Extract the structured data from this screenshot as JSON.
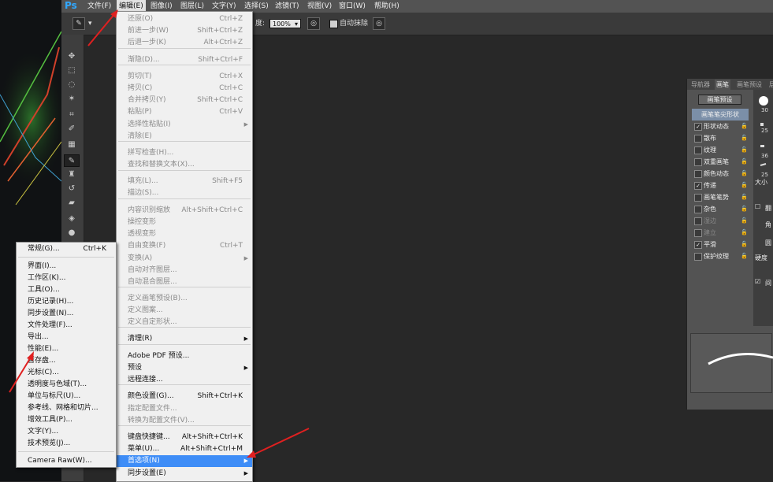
{
  "app": {
    "logo": "Ps"
  },
  "menubar": {
    "items": [
      {
        "label": "文件(F)"
      },
      {
        "label": "编辑(E)"
      },
      {
        "label": "图像(I)"
      },
      {
        "label": "图层(L)"
      },
      {
        "label": "文字(Y)"
      },
      {
        "label": "选择(S)"
      },
      {
        "label": "滤镜(T)"
      },
      {
        "label": "视图(V)"
      },
      {
        "label": "窗口(W)"
      },
      {
        "label": "帮助(H)"
      }
    ]
  },
  "options": {
    "opacity_label": "度:",
    "opacity_value": "100%",
    "auto_erase": "自动抹除"
  },
  "edit_menu": {
    "items": [
      {
        "label": "还原(O)",
        "shortcut": "Ctrl+Z",
        "disabled": true
      },
      {
        "label": "前进一步(W)",
        "shortcut": "Shift+Ctrl+Z",
        "disabled": true
      },
      {
        "label": "后退一步(K)",
        "shortcut": "Alt+Ctrl+Z",
        "disabled": true
      },
      {
        "label": "渐隐(D)...",
        "shortcut": "Shift+Ctrl+F",
        "disabled": true
      },
      {
        "label": "剪切(T)",
        "shortcut": "Ctrl+X",
        "disabled": true
      },
      {
        "label": "拷贝(C)",
        "shortcut": "Ctrl+C",
        "disabled": true
      },
      {
        "label": "合并拷贝(Y)",
        "shortcut": "Shift+Ctrl+C",
        "disabled": true
      },
      {
        "label": "粘贴(P)",
        "shortcut": "Ctrl+V",
        "disabled": true
      },
      {
        "label": "选择性粘贴(I)",
        "shortcut": "",
        "disabled": true
      },
      {
        "label": "清除(E)",
        "shortcut": "",
        "disabled": true
      },
      {
        "label": "拼写检查(H)...",
        "shortcut": "",
        "disabled": true
      },
      {
        "label": "查找和替换文本(X)...",
        "shortcut": "",
        "disabled": true
      },
      {
        "label": "填充(L)...",
        "shortcut": "Shift+F5",
        "disabled": true
      },
      {
        "label": "描边(S)...",
        "shortcut": "",
        "disabled": true
      },
      {
        "label": "内容识别缩放",
        "shortcut": "Alt+Shift+Ctrl+C",
        "disabled": true
      },
      {
        "label": "操控变形",
        "shortcut": "",
        "disabled": true
      },
      {
        "label": "透视变形",
        "shortcut": "",
        "disabled": true
      },
      {
        "label": "自由变换(F)",
        "shortcut": "Ctrl+T",
        "disabled": true
      },
      {
        "label": "变换(A)",
        "shortcut": "",
        "disabled": true
      },
      {
        "label": "自动对齐图层...",
        "shortcut": "",
        "disabled": true
      },
      {
        "label": "自动混合图层...",
        "shortcut": "",
        "disabled": true
      },
      {
        "label": "定义画笔预设(B)...",
        "shortcut": "",
        "disabled": true
      },
      {
        "label": "定义图案...",
        "shortcut": "",
        "disabled": true
      },
      {
        "label": "定义自定形状...",
        "shortcut": "",
        "disabled": true
      },
      {
        "label": "清理(R)",
        "shortcut": "",
        "disabled": false
      },
      {
        "label": "Adobe PDF 预设...",
        "shortcut": "",
        "disabled": false
      },
      {
        "label": "预设",
        "shortcut": "",
        "disabled": false
      },
      {
        "label": "远程连接...",
        "shortcut": "",
        "disabled": false
      },
      {
        "label": "颜色设置(G)...",
        "shortcut": "Shift+Ctrl+K",
        "disabled": false
      },
      {
        "label": "指定配置文件...",
        "shortcut": "",
        "disabled": true
      },
      {
        "label": "转换为配置文件(V)...",
        "shortcut": "",
        "disabled": true
      },
      {
        "label": "键盘快捷键...",
        "shortcut": "Alt+Shift+Ctrl+K",
        "disabled": false
      },
      {
        "label": "菜单(U)...",
        "shortcut": "Alt+Shift+Ctrl+M",
        "disabled": false
      },
      {
        "label": "首选项(N)",
        "shortcut": "",
        "disabled": false
      },
      {
        "label": "同步设置(E)",
        "shortcut": "",
        "disabled": false
      }
    ]
  },
  "prefs_menu": {
    "items": [
      {
        "label": "常规(G)...",
        "shortcut": "Ctrl+K"
      },
      {
        "label": "界面(I)...",
        "shortcut": ""
      },
      {
        "label": "工作区(K)...",
        "shortcut": ""
      },
      {
        "label": "工具(O)...",
        "shortcut": ""
      },
      {
        "label": "历史记录(H)...",
        "shortcut": ""
      },
      {
        "label": "同步设置(N)...",
        "shortcut": ""
      },
      {
        "label": "文件处理(F)...",
        "shortcut": ""
      },
      {
        "label": "导出...",
        "shortcut": ""
      },
      {
        "label": "性能(E)...",
        "shortcut": ""
      },
      {
        "label": "暂存盘...",
        "shortcut": ""
      },
      {
        "label": "光标(C)...",
        "shortcut": ""
      },
      {
        "label": "透明度与色域(T)...",
        "shortcut": ""
      },
      {
        "label": "单位与标尺(U)...",
        "shortcut": ""
      },
      {
        "label": "参考线、网格和切片...",
        "shortcut": ""
      },
      {
        "label": "增效工具(P)...",
        "shortcut": ""
      },
      {
        "label": "文字(Y)...",
        "shortcut": ""
      },
      {
        "label": "技术预览(J)...",
        "shortcut": ""
      },
      {
        "label": "Camera Raw(W)...",
        "shortcut": ""
      }
    ]
  },
  "brush_panel": {
    "tabs": [
      {
        "label": "导航器"
      },
      {
        "label": "画笔"
      },
      {
        "label": "画笔预设"
      },
      {
        "label": "层"
      }
    ],
    "preset_button": "画笔预设",
    "items": [
      {
        "label": "画笔笔尖形状",
        "checked": false,
        "header": true,
        "disabled": false
      },
      {
        "label": "形状动态",
        "checked": true,
        "header": false,
        "disabled": false
      },
      {
        "label": "散布",
        "checked": false,
        "header": false,
        "disabled": false
      },
      {
        "label": "纹理",
        "checked": false,
        "header": false,
        "disabled": false
      },
      {
        "label": "双重画笔",
        "checked": false,
        "header": false,
        "disabled": false
      },
      {
        "label": "颜色动态",
        "checked": false,
        "header": false,
        "disabled": false
      },
      {
        "label": "传递",
        "checked": true,
        "header": false,
        "disabled": false
      },
      {
        "label": "画笔笔势",
        "checked": false,
        "header": false,
        "disabled": false
      },
      {
        "label": "杂色",
        "checked": false,
        "header": false,
        "disabled": false
      },
      {
        "label": "湿边",
        "checked": false,
        "header": false,
        "disabled": true
      },
      {
        "label": "建立",
        "checked": false,
        "header": false,
        "disabled": true
      },
      {
        "label": "平滑",
        "checked": true,
        "header": false,
        "disabled": false
      },
      {
        "label": "保护纹理",
        "checked": false,
        "header": false,
        "disabled": false
      }
    ],
    "sizes": [
      "30",
      "25",
      "36",
      "25"
    ],
    "size_label": "大小",
    "hardness_label": "硬度",
    "flip_label": "翻",
    "angle_label": "角",
    "round_label": "圆",
    "spacing_label": "间"
  },
  "colors": {
    "accent": "#3e8df7",
    "arrow": "#e02020",
    "logo": "#31a8ff"
  }
}
